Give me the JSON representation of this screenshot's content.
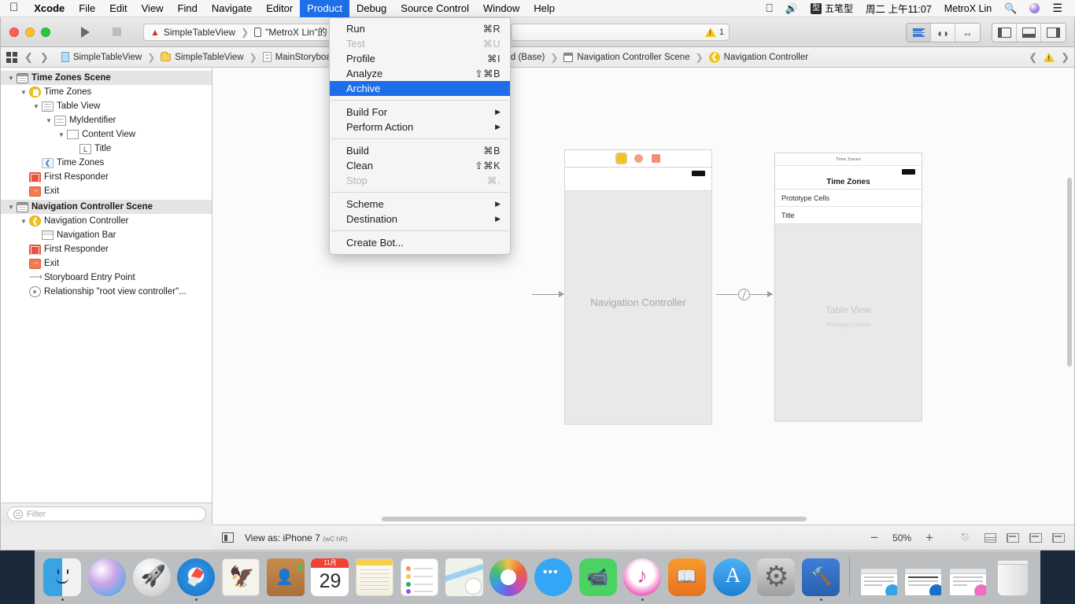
{
  "menubar": {
    "apple_icon": "apple-logo-icon",
    "items": [
      {
        "label": "Xcode",
        "bold": true
      },
      {
        "label": "File"
      },
      {
        "label": "Edit"
      },
      {
        "label": "View"
      },
      {
        "label": "Find"
      },
      {
        "label": "Navigate"
      },
      {
        "label": "Editor"
      },
      {
        "label": "Product",
        "active": true
      },
      {
        "label": "Debug"
      },
      {
        "label": "Source Control"
      },
      {
        "label": "Window"
      },
      {
        "label": "Help"
      }
    ],
    "status": {
      "display_icon": "display-mirroring-icon",
      "volume_icon": "speaker-volume-icon",
      "ime_badge": "型",
      "ime_label": "五笔型",
      "datetime": "周二 上午11:07",
      "user": "MetroX Lin",
      "search_icon": "search-icon",
      "siri_icon": "siri-icon",
      "controlcenter_icon": "notification-center-icon"
    }
  },
  "product_menu": {
    "groups": [
      [
        {
          "label": "Run",
          "shortcut": "⌘R",
          "enabled": true
        },
        {
          "label": "Test",
          "shortcut": "⌘U",
          "enabled": false
        },
        {
          "label": "Profile",
          "shortcut": "⌘I",
          "enabled": true
        },
        {
          "label": "Analyze",
          "shortcut": "⇧⌘B",
          "enabled": true
        },
        {
          "label": "Archive",
          "shortcut": "",
          "enabled": true,
          "selected": true
        }
      ],
      [
        {
          "label": "Build For",
          "shortcut": "",
          "submenu": true,
          "enabled": true
        },
        {
          "label": "Perform Action",
          "shortcut": "",
          "submenu": true,
          "enabled": true
        }
      ],
      [
        {
          "label": "Build",
          "shortcut": "⌘B",
          "enabled": true
        },
        {
          "label": "Clean",
          "shortcut": "⇧⌘K",
          "enabled": true
        },
        {
          "label": "Stop",
          "shortcut": "⌘.",
          "enabled": false
        }
      ],
      [
        {
          "label": "Scheme",
          "shortcut": "",
          "submenu": true,
          "enabled": true
        },
        {
          "label": "Destination",
          "shortcut": "",
          "submenu": true,
          "enabled": true
        }
      ],
      [
        {
          "label": "Create Bot...",
          "shortcut": "",
          "enabled": true
        }
      ]
    ]
  },
  "toolbar": {
    "run_icon": "run-play-icon",
    "stop_icon": "stop-square-icon",
    "scheme_name": "SimpleTableView",
    "destination_name": "\"MetroX Lin\"的 iPad",
    "warning_count": "1",
    "warning_icon": "warning-triangle-icon",
    "editor_modes": [
      {
        "name": "standard-editor",
        "selected": true
      },
      {
        "name": "assistant-editor",
        "selected": false
      },
      {
        "name": "version-editor",
        "selected": false
      }
    ],
    "panel_toggles": [
      {
        "name": "navigator-panel-toggle"
      },
      {
        "name": "debug-panel-toggle"
      },
      {
        "name": "utilities-panel-toggle"
      }
    ]
  },
  "jumpbar": {
    "related_icon": "related-items-icon",
    "back_icon": "back-chevron-icon",
    "forward_icon": "forward-chevron-icon",
    "crumbs": [
      {
        "label": "SimpleTableView",
        "icon": "project-icon"
      },
      {
        "label": "SimpleTableView",
        "icon": "folder-icon"
      },
      {
        "label": "MainStoryboard",
        "icon": "storyboard-icon"
      },
      {
        "label": "d (Base)",
        "icon": ""
      },
      {
        "label": "Navigation Controller Scene",
        "icon": "scene-icon"
      },
      {
        "label": "Navigation Controller",
        "icon": "navigation-controller-icon"
      }
    ],
    "issue_prev_icon": "previous-issue-icon",
    "issue_warning_icon": "warning-triangle-icon",
    "issue_next_icon": "next-issue-icon"
  },
  "outline": {
    "rows": [
      {
        "label": "Time Zones Scene",
        "indent": 0,
        "disclosure": "▼",
        "icon": "scene-icon",
        "scene": true
      },
      {
        "label": "Time Zones",
        "indent": 1,
        "disclosure": "▼",
        "icon": "view-controller-icon"
      },
      {
        "label": "Table View",
        "indent": 2,
        "disclosure": "▼",
        "icon": "table-view-icon"
      },
      {
        "label": "MyIdentifier",
        "indent": 3,
        "disclosure": "▼",
        "icon": "table-view-cell-icon"
      },
      {
        "label": "Content View",
        "indent": 4,
        "disclosure": "▼",
        "icon": "view-icon"
      },
      {
        "label": "Title",
        "indent": 5,
        "disclosure": "",
        "icon": "label-icon"
      },
      {
        "label": "Time Zones",
        "indent": 2,
        "disclosure": "",
        "icon": "navigation-item-icon"
      },
      {
        "label": "First Responder",
        "indent": 1,
        "disclosure": "",
        "icon": "first-responder-icon"
      },
      {
        "label": "Exit",
        "indent": 1,
        "disclosure": "",
        "icon": "exit-icon"
      },
      {
        "label": "Navigation Controller Scene",
        "indent": 0,
        "disclosure": "▼",
        "icon": "scene-icon",
        "scene": true
      },
      {
        "label": "Navigation Controller",
        "indent": 1,
        "disclosure": "▼",
        "icon": "navigation-controller-icon"
      },
      {
        "label": "Navigation Bar",
        "indent": 2,
        "disclosure": "",
        "icon": "navigation-bar-icon"
      },
      {
        "label": "First Responder",
        "indent": 1,
        "disclosure": "",
        "icon": "first-responder-icon"
      },
      {
        "label": "Exit",
        "indent": 1,
        "disclosure": "",
        "icon": "exit-icon"
      },
      {
        "label": "Storyboard Entry Point",
        "indent": 1,
        "disclosure": "",
        "icon": "entry-point-arrow-icon"
      },
      {
        "label": "Relationship \"root view controller\"...",
        "indent": 1,
        "disclosure": "",
        "icon": "relationship-segue-icon"
      }
    ],
    "filter_placeholder": "Filter",
    "filter_value": "",
    "filter_icon": "filter-icon"
  },
  "canvas": {
    "nav_scene": {
      "label": "Navigation Controller",
      "status_badges": [
        "signal-badge",
        "wifi-badge",
        "battery-badge"
      ]
    },
    "table_scene": {
      "status_title": "Time Zones",
      "nav_title": "Time Zones",
      "section_header": "Prototype Cells",
      "cell_label": "Title",
      "body_label": "Table View",
      "body_sublabel": "Prototype Content"
    },
    "segue_icon": "relationship-segue-icon",
    "entry_arrow_icon": "entry-point-arrow-icon"
  },
  "bottombar": {
    "device_icon": "device-preview-icon",
    "view_as_label": "View as: iPhone 7",
    "size_class": "(wC hR)",
    "zoom_out_icon": "zoom-out-icon",
    "zoom_level": "50%",
    "zoom_in_icon": "zoom-in-icon",
    "tools": [
      {
        "name": "resolve-auto-layout-issues-icon"
      },
      {
        "name": "update-frames-icon"
      },
      {
        "name": "align-icon"
      },
      {
        "name": "pin-icon"
      },
      {
        "name": "embed-in-icon"
      }
    ]
  },
  "dock": {
    "items": [
      {
        "name": "finder",
        "running": true
      },
      {
        "name": "siri",
        "running": false
      },
      {
        "name": "launchpad",
        "running": false
      },
      {
        "name": "safari",
        "running": true
      },
      {
        "name": "mail",
        "running": false
      },
      {
        "name": "contacts",
        "running": false
      },
      {
        "name": "calendar",
        "running": false,
        "month": "11月",
        "day": "29"
      },
      {
        "name": "notes",
        "running": false
      },
      {
        "name": "reminders",
        "running": false
      },
      {
        "name": "maps",
        "running": false
      },
      {
        "name": "photos",
        "running": false
      },
      {
        "name": "messages",
        "running": false
      },
      {
        "name": "facetime",
        "running": false
      },
      {
        "name": "itunes",
        "running": true
      },
      {
        "name": "ibooks",
        "running": false
      },
      {
        "name": "app-store",
        "running": false
      },
      {
        "name": "system-preferences",
        "running": false
      },
      {
        "name": "xcode",
        "running": true
      }
    ],
    "minimized": [
      {
        "name": "minimized-window-finder"
      },
      {
        "name": "minimized-window-safari"
      },
      {
        "name": "minimized-window-itunes"
      }
    ],
    "trash": {
      "name": "trash"
    }
  }
}
